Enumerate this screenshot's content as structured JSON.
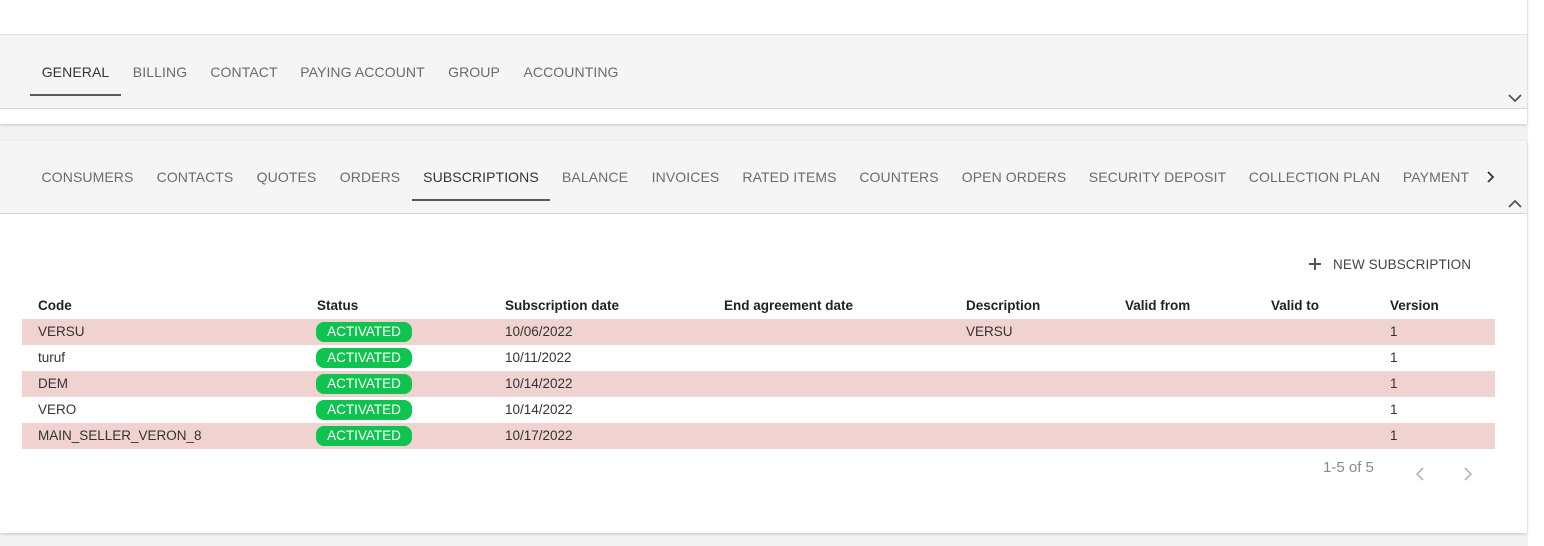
{
  "top_tabs": [
    {
      "label": "GENERAL",
      "active": true
    },
    {
      "label": "BILLING",
      "active": false
    },
    {
      "label": "CONTACT",
      "active": false
    },
    {
      "label": "PAYING ACCOUNT",
      "active": false
    },
    {
      "label": "GROUP",
      "active": false
    },
    {
      "label": "ACCOUNTING",
      "active": false
    }
  ],
  "main_tabs": [
    {
      "label": "CONSUMERS",
      "active": false
    },
    {
      "label": "CONTACTS",
      "active": false
    },
    {
      "label": "QUOTES",
      "active": false
    },
    {
      "label": "ORDERS",
      "active": false
    },
    {
      "label": "SUBSCRIPTIONS",
      "active": true
    },
    {
      "label": "BALANCE",
      "active": false
    },
    {
      "label": "INVOICES",
      "active": false
    },
    {
      "label": "RATED ITEMS",
      "active": false
    },
    {
      "label": "COUNTERS",
      "active": false
    },
    {
      "label": "OPEN ORDERS",
      "active": false
    },
    {
      "label": "SECURITY DEPOSIT",
      "active": false
    },
    {
      "label": "COLLECTION PLAN",
      "active": false
    },
    {
      "label": "PAYMENT",
      "active": false
    }
  ],
  "actions": {
    "new_subscription": "NEW SUBSCRIPTION"
  },
  "table": {
    "columns": [
      "Code",
      "Status",
      "Subscription date",
      "End agreement date",
      "Description",
      "Valid from",
      "Valid to",
      "Version"
    ],
    "rows": [
      {
        "code": "VERSU",
        "status": "ACTIVATED",
        "subscription_date": "10/06/2022",
        "end_agreement_date": "",
        "description": "VERSU",
        "valid_from": "",
        "valid_to": "",
        "version": "1"
      },
      {
        "code": "turuf",
        "status": "ACTIVATED",
        "subscription_date": "10/11/2022",
        "end_agreement_date": "",
        "description": "",
        "valid_from": "",
        "valid_to": "",
        "version": "1"
      },
      {
        "code": "DEM",
        "status": "ACTIVATED",
        "subscription_date": "10/14/2022",
        "end_agreement_date": "",
        "description": "",
        "valid_from": "",
        "valid_to": "",
        "version": "1"
      },
      {
        "code": "VERO",
        "status": "ACTIVATED",
        "subscription_date": "10/14/2022",
        "end_agreement_date": "",
        "description": "",
        "valid_from": "",
        "valid_to": "",
        "version": "1"
      },
      {
        "code": "MAIN_SELLER_VERON_8",
        "status": "ACTIVATED",
        "subscription_date": "10/17/2022",
        "end_agreement_date": "",
        "description": "",
        "valid_from": "",
        "valid_to": "",
        "version": "1"
      }
    ]
  },
  "pagination": {
    "range": "1-5 of 5"
  },
  "colors": {
    "status_activated": "#10c24f",
    "row_highlight": "#f0d3d0",
    "tab_indicator": "#5a5a5a"
  }
}
